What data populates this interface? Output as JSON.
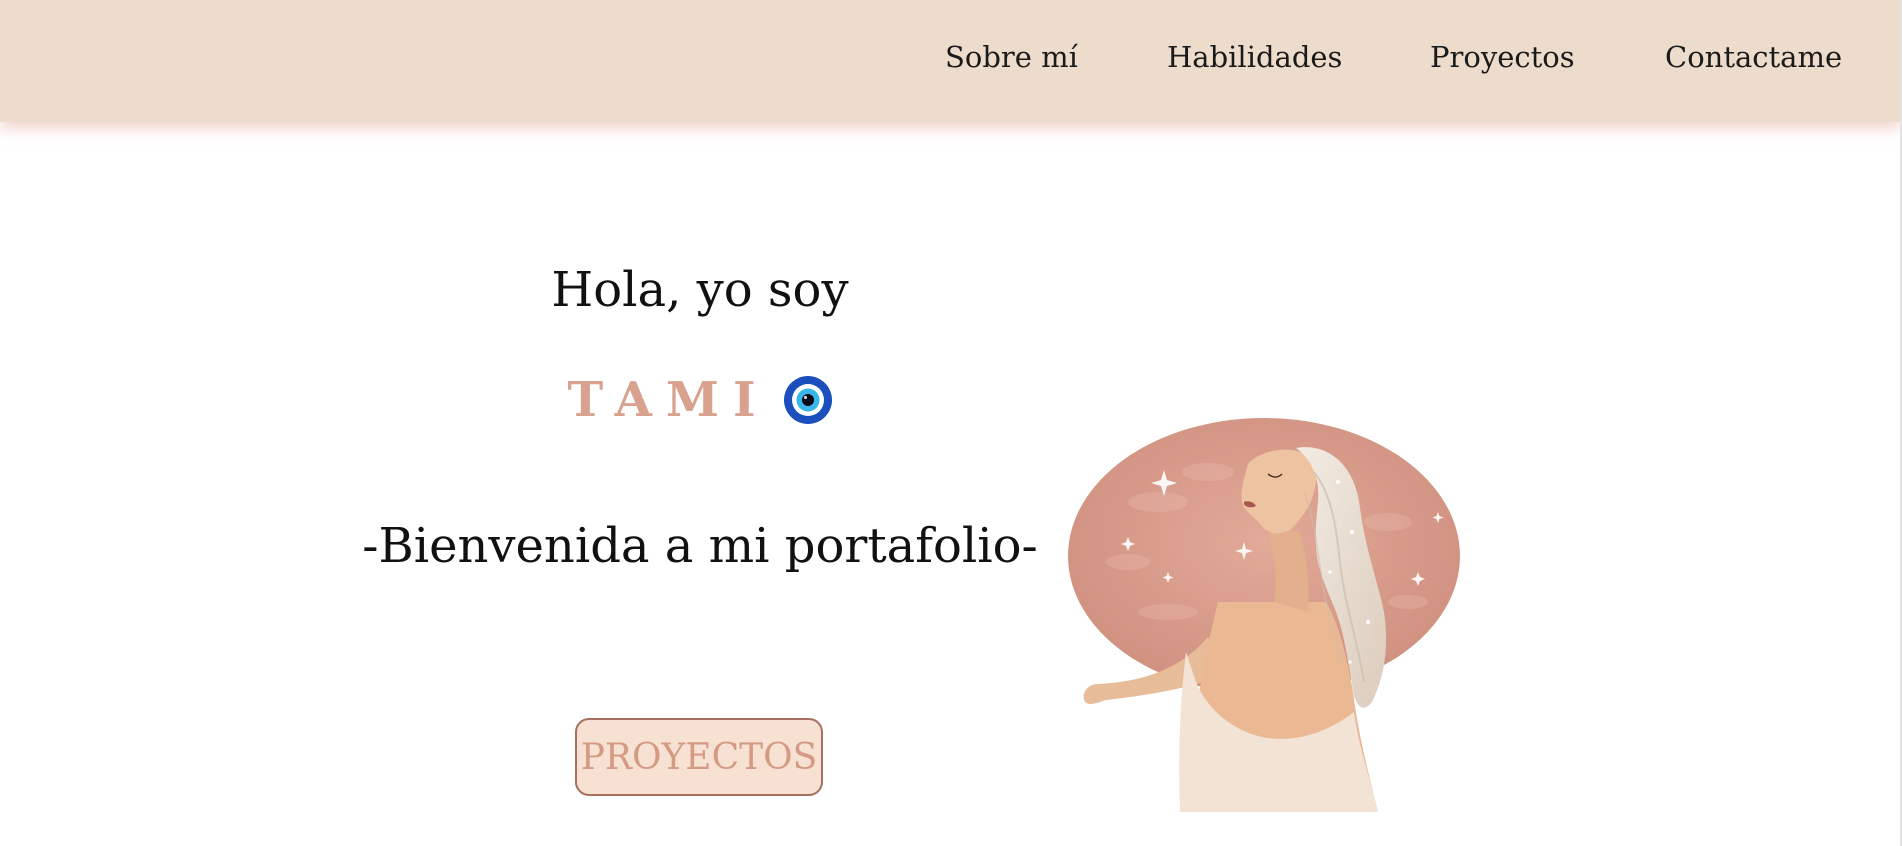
{
  "nav": {
    "items": [
      {
        "label": "Sobre mí"
      },
      {
        "label": "Habilidades"
      },
      {
        "label": "Proyectos"
      },
      {
        "label": "Contactame"
      }
    ]
  },
  "hero": {
    "greeting": "Hola, yo soy",
    "name": "TAMI",
    "tagline": "-Bienvenida a mi portafolio-",
    "cta_label": "PROYECTOS"
  },
  "colors": {
    "header_bg": "#eddccc",
    "accent_name": "#d9a28e",
    "button_bg": "#f6e1d2",
    "button_border": "#a5705f",
    "circle_bg": "#d89c8c",
    "eye_blue": "#1b4fbd"
  },
  "icons": {
    "evil_eye": "nazar-evil-eye-icon",
    "illustration": "woman-portrait-illustration"
  }
}
